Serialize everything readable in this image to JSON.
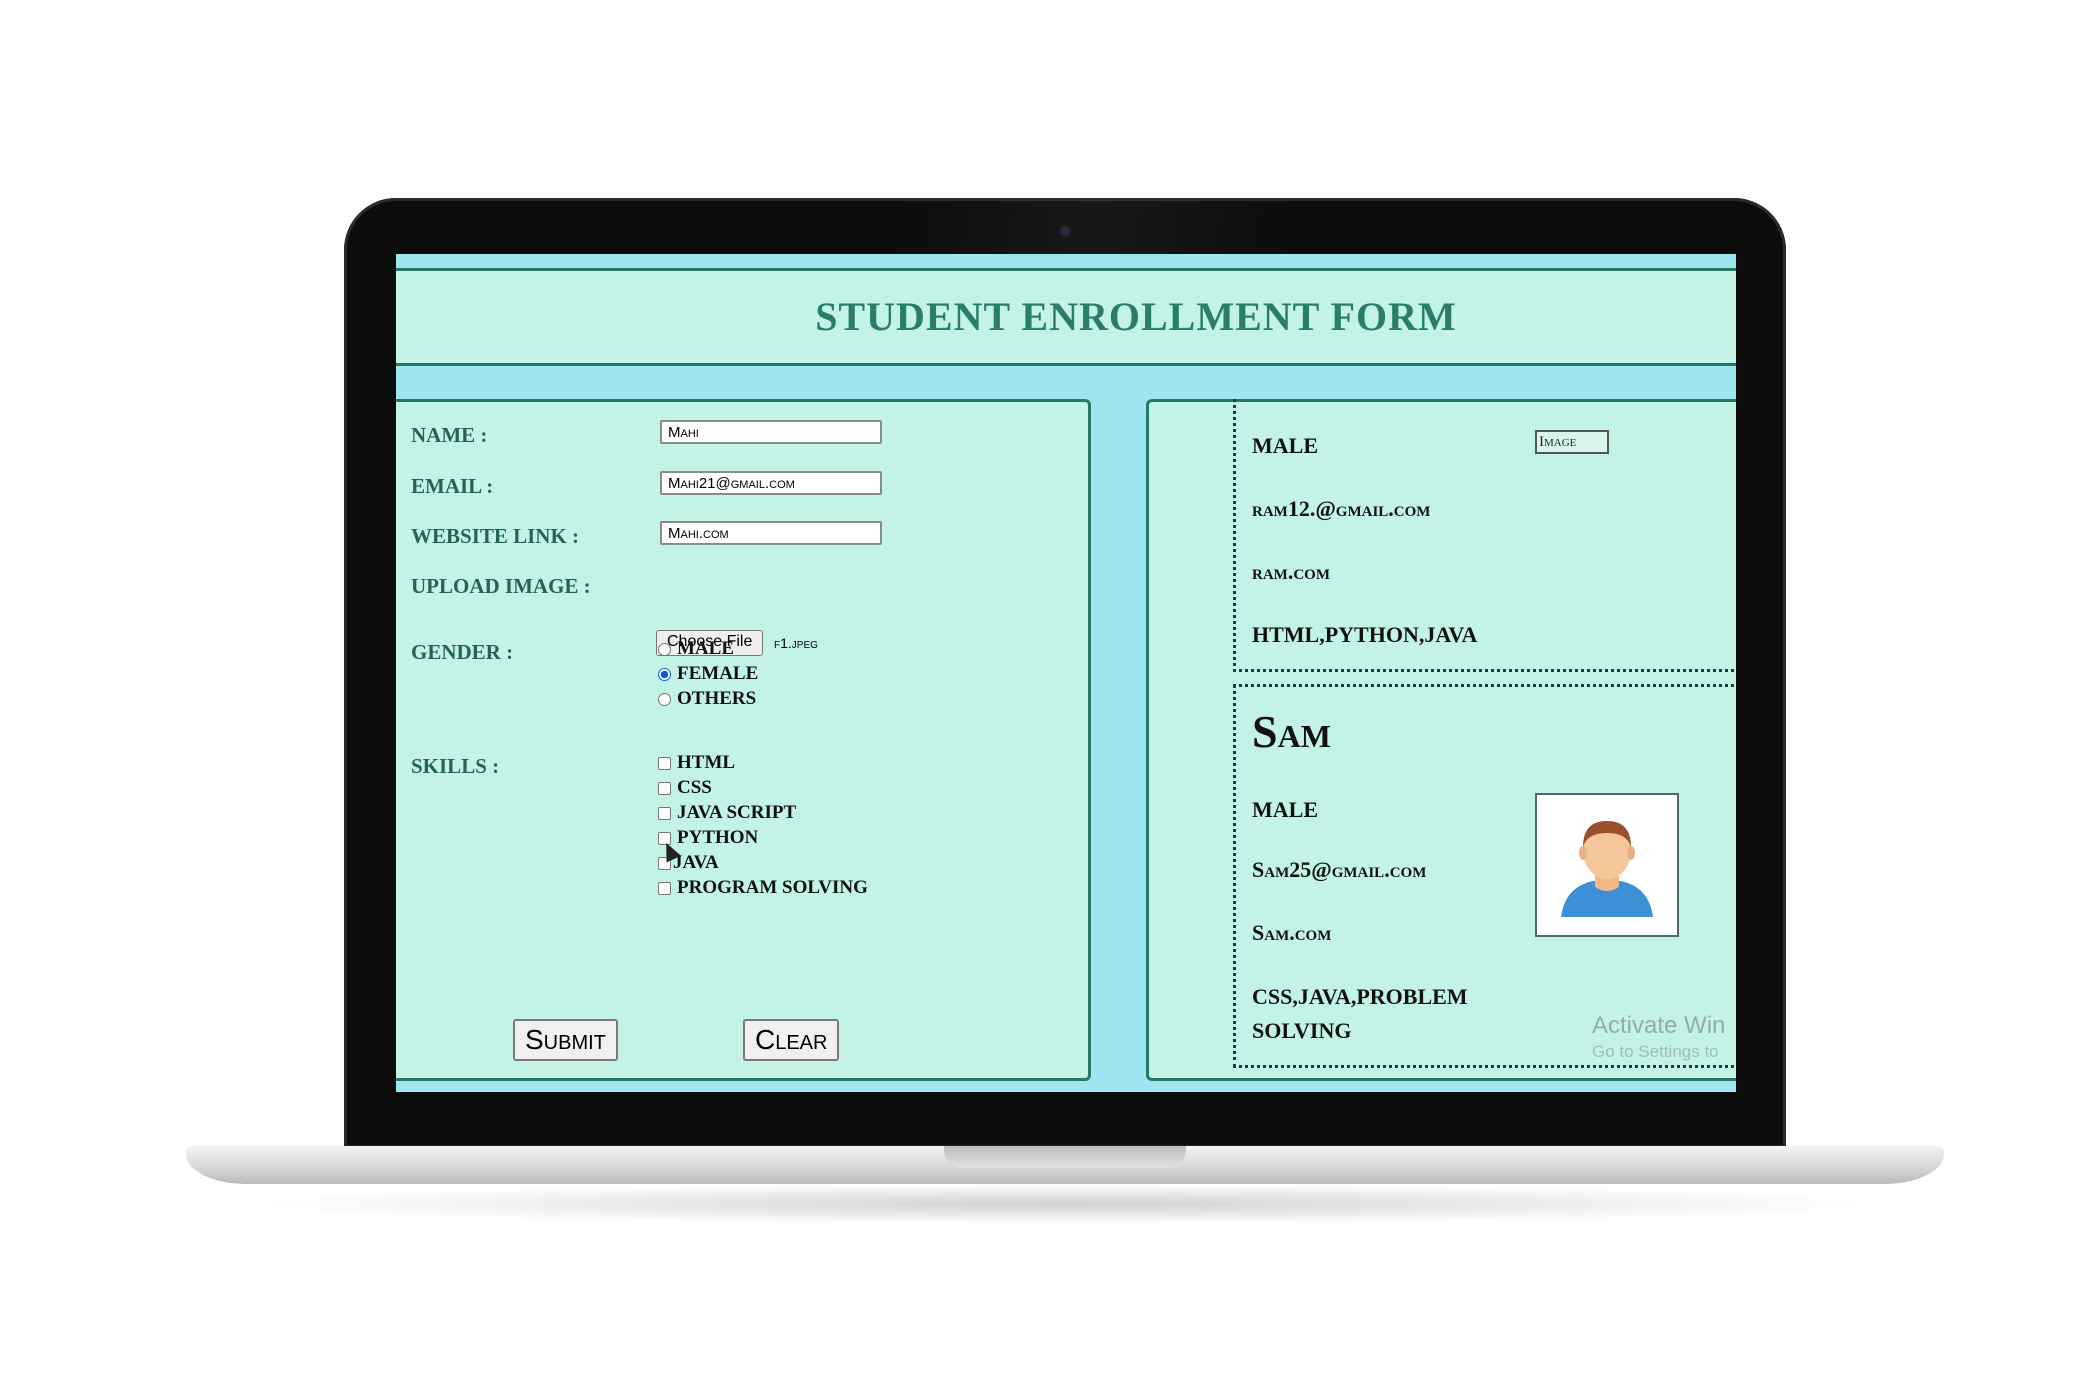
{
  "form": {
    "title": "STUDENT ENROLLMENT FORM",
    "name_label": "NAME :",
    "name_value": "Mahi",
    "email_label": "EMAIL :",
    "email_value": "Mahi21@gmail.com",
    "website_label": "WEBSITE LINK :",
    "website_value": "Mahi.com",
    "upload_label": "UPLOAD IMAGE :",
    "choose_file_label": "Choose File",
    "file_name": "f1.jpeg",
    "gender_label": "GENDER :",
    "gender_options": [
      "MALE",
      "FEMALE",
      "OTHERS"
    ],
    "gender_selected": "FEMALE",
    "skills_label": "SKILLS :",
    "skills_options": [
      "HTML",
      "CSS",
      "JAVA SCRIPT",
      "PYTHON",
      "JAVA",
      "PROGRAM SOLVING"
    ],
    "submit_label": "Submit",
    "clear_label": "Clear"
  },
  "records": [
    {
      "gender": "MALE",
      "email": "ram12.@gmail.com",
      "website": "ram.com",
      "skills": "HTML,PYTHON,JAVA",
      "image_alt": "Image"
    },
    {
      "name": "Sam",
      "gender": "MALE",
      "email": "Sam25@gmail.com",
      "website": "Sam.com",
      "skills_line1": "CSS,JAVA,PROBLEM",
      "skills_line2": "SOLVING",
      "avatar_icon": "user-avatar-icon"
    }
  ],
  "watermark": {
    "line1": "Activate Win",
    "line2": "Go to Settings to"
  },
  "colors": {
    "panel_bg": "#c2f3e6",
    "page_bg": "#9de6f0",
    "title_color": "#2b7d69",
    "border": "#267a65"
  }
}
